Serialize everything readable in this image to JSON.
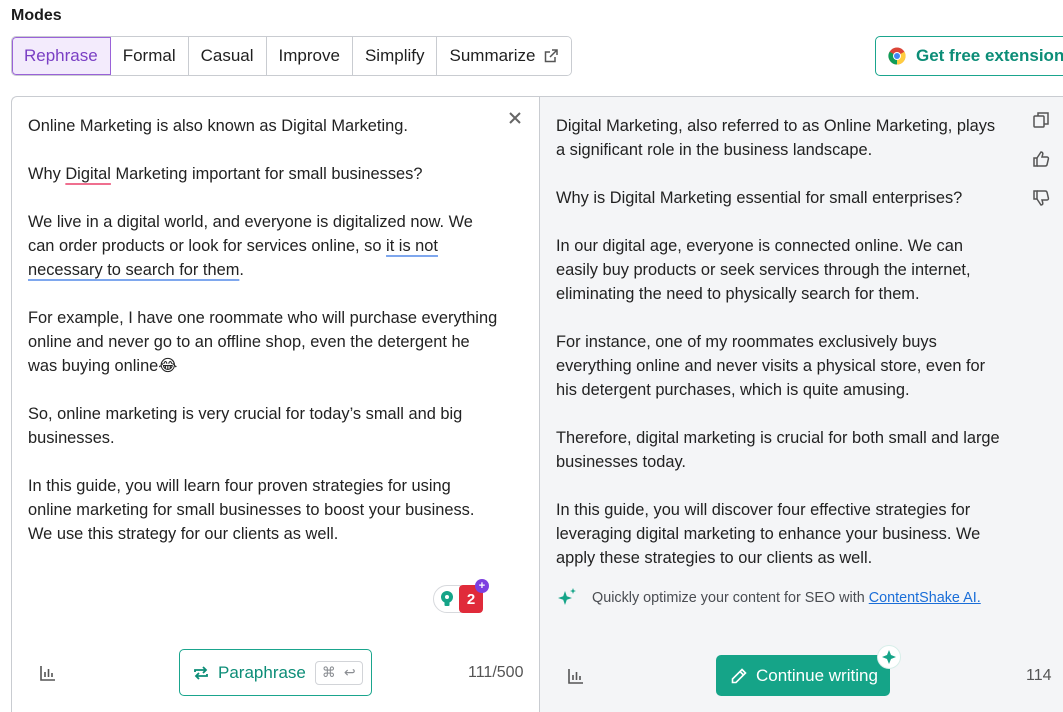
{
  "modes": {
    "title": "Modes",
    "items": [
      {
        "label": "Rephrase",
        "active": true
      },
      {
        "label": "Formal",
        "active": false
      },
      {
        "label": "Casual",
        "active": false
      },
      {
        "label": "Improve",
        "active": false
      },
      {
        "label": "Simplify",
        "active": false
      },
      {
        "label": "Summarize",
        "active": false
      }
    ]
  },
  "extension_button": {
    "label": "Get free extension"
  },
  "input": {
    "p1": "Online Marketing is also known as Digital Marketing.",
    "p2_before": "Why ",
    "p2_flag": "Digital",
    "p2_after": " Marketing important for small businesses?",
    "p3_before": "We live in a digital world, and everyone is digitalized now. We can order products or look for services online, so ",
    "p3_flag": "it is not necessary to search for them",
    "p3_after": ".",
    "p4": "For example, I have one roommate who will purchase everything online and never go to an offline shop, even the detergent he was buying online😂",
    "p5": "So, online marketing is very crucial for today’s small and big businesses.",
    "p6": "In this guide, you will learn four proven strategies for using online marketing for small businesses to boost your business. We use this strategy for our clients as well.",
    "issue_count": "2",
    "word_counter": "111/500"
  },
  "paraphrase_button": {
    "label": "Paraphrase",
    "shortcut_cmd": "⌘",
    "shortcut_enter": "↩"
  },
  "output": {
    "p1": "Digital Marketing, also referred to as Online Marketing, plays a significant role in the business landscape.",
    "p2": "Why is Digital Marketing essential for small enterprises?",
    "p3": "In our digital age, everyone is connected online. We can easily buy products or seek services through the internet, eliminating the need to physically search for them.",
    "p4": "For instance, one of my roommates exclusively buys everything online and never visits a physical store, even for his detergent purchases, which is quite amusing.",
    "p5": "Therefore, digital marketing is crucial for both small and large businesses today.",
    "p6": "In this guide, you will discover four effective strategies for leveraging digital marketing to enhance your business. We apply these strategies to our clients as well.",
    "word_count": "114"
  },
  "seo": {
    "text": "Quickly optimize your content for SEO with",
    "link": "ContentShake AI."
  },
  "continue_button": {
    "label": "Continue writing"
  },
  "colors": {
    "accent_green": "#15a488",
    "accent_purple": "#7a3fc4",
    "error_red": "#e02b3a"
  }
}
